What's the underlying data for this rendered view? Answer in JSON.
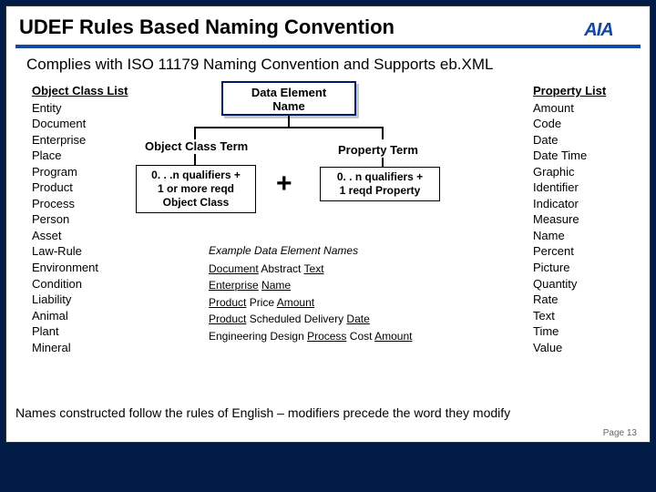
{
  "title": "UDEF Rules Based Naming Convention",
  "subtitle": "Complies with ISO 11179 Naming Convention and Supports eb.XML",
  "logo": {
    "acronym": "AIA"
  },
  "object_class_list": {
    "header": "Object Class List",
    "items": [
      "Entity",
      "Document",
      "Enterprise",
      "Place",
      "Program",
      "Product",
      "Process",
      "Person",
      "Asset",
      "Law-Rule",
      "Environment",
      "Condition",
      "Liability",
      "Animal",
      "Plant",
      "Mineral"
    ]
  },
  "property_list": {
    "header": "Property List",
    "items": [
      "Amount",
      "Code",
      "Date",
      "Date Time",
      "Graphic",
      "Identifier",
      "Indicator",
      "Measure",
      "Name",
      "Percent",
      "Picture",
      "Quantity",
      "Rate",
      "Text",
      "Time",
      "Value"
    ]
  },
  "diagram": {
    "data_element_box_l1": "Data Element",
    "data_element_box_l2": "Name",
    "object_class_term": "Object Class Term",
    "property_term": "Property Term",
    "plus": "+",
    "left_qual_l1": "0. . .n qualifiers +",
    "left_qual_l2": "1 or more reqd",
    "left_qual_l3": "Object Class",
    "right_qual_l1": "0. . n qualifiers +",
    "right_qual_l2": "1 reqd Property"
  },
  "examples": {
    "header": "Example Data Element Names",
    "rows": [
      {
        "pre": "",
        "u1": "Document",
        "mid": " Abstract ",
        "u2": "Text",
        "post": ""
      },
      {
        "pre": "",
        "u1": "Enterprise",
        "mid": " ",
        "u2": "Name",
        "post": ""
      },
      {
        "pre": "",
        "u1": "Product",
        "mid": " Price ",
        "u2": "Amount",
        "post": ""
      },
      {
        "pre": "",
        "u1": "Product",
        "mid": " Scheduled Delivery ",
        "u2": "Date",
        "post": ""
      },
      {
        "pre": "Engineering Design ",
        "u1": "Process",
        "mid": " Cost ",
        "u2": "Amount",
        "post": ""
      }
    ]
  },
  "footer": "Names constructed follow the rules of English – modifiers precede the word they modify",
  "page": "Page 13"
}
